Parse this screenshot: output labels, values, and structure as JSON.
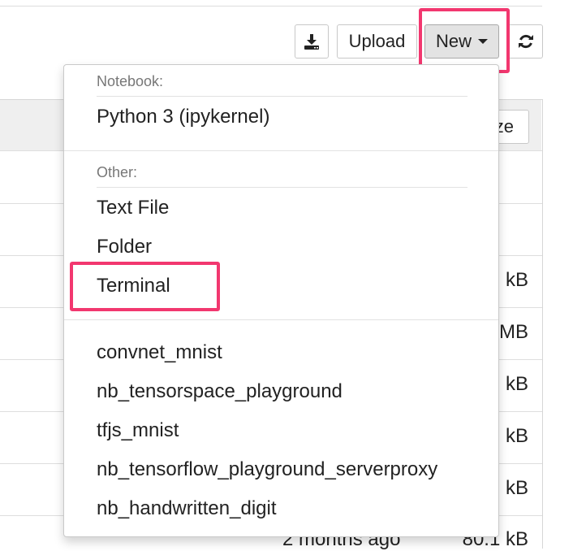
{
  "toolbar": {
    "upload_label": "Upload",
    "new_label": "New"
  },
  "file_list": {
    "sort_button_partial": "ze",
    "sizes": [
      "kB",
      "MB",
      "kB",
      "kB",
      "kB",
      "80.1 kB"
    ],
    "last_row_modified": "2 months ago"
  },
  "new_menu": {
    "notebook_header": "Notebook:",
    "notebook_items": [
      "Python 3 (ipykernel)"
    ],
    "other_header": "Other:",
    "other_items": [
      "Text File",
      "Folder",
      "Terminal"
    ],
    "server_proxy_items": [
      "convnet_mnist",
      "nb_tensorspace_playground",
      "tfjs_mnist",
      "nb_tensorflow_playground_serverproxy",
      "nb_handwritten_digit"
    ]
  },
  "colors": {
    "highlight": "#f2376f",
    "menu_header": "#777777",
    "new_button_active": "#e3e3e3"
  },
  "icons": {
    "download": "download-icon",
    "refresh": "refresh-icon",
    "caret": "caret-down-icon"
  }
}
